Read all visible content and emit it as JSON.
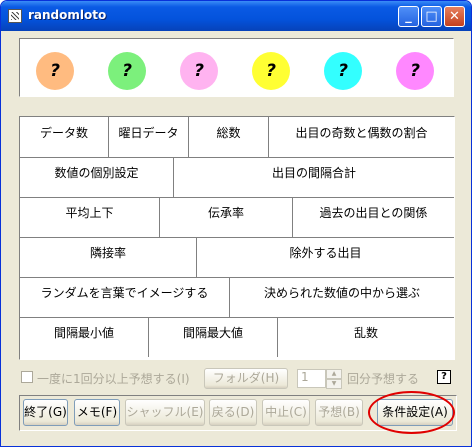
{
  "window": {
    "title": "randomloto",
    "controls": {
      "minimize": "_",
      "maximize": "□",
      "close": "✕"
    }
  },
  "balls": [
    {
      "text": "?",
      "color": "#ffbb80"
    },
    {
      "text": "?",
      "color": "#7cf07c"
    },
    {
      "text": "?",
      "color": "#ffb3f0"
    },
    {
      "text": "?",
      "color": "#ffff33"
    },
    {
      "text": "?",
      "color": "#33ffff"
    },
    {
      "text": "?",
      "color": "#ff88ff"
    }
  ],
  "grid": {
    "row1": [
      "データ数",
      "曜日データ",
      "総数",
      "出目の奇数と偶数の割合"
    ],
    "row2": [
      "数値の個別設定",
      "出目の間隔合計"
    ],
    "row3": [
      "平均上下",
      "伝承率",
      "過去の出目との関係"
    ],
    "row4": [
      "隣接率",
      "除外する出目"
    ],
    "row5": [
      "ランダムを言葉でイメージする",
      "決められた数値の中から選ぶ"
    ],
    "row6": [
      "間隔最小値",
      "間隔最大値",
      "乱数"
    ]
  },
  "options": {
    "checkbox_label": "一度に1回分以上予想する(I)",
    "folder_button": "フォルダ(H)",
    "count_value": "1",
    "count_suffix": "回分予想する",
    "help_icon": "?"
  },
  "buttons": {
    "exit": "終了(G)",
    "memo": "メモ(F)",
    "shuffle": "シャッフル(E)",
    "back": "戻る(D)",
    "stop": "中止(C)",
    "predict": "予想(B)",
    "conditions": "条件設定(A)"
  }
}
